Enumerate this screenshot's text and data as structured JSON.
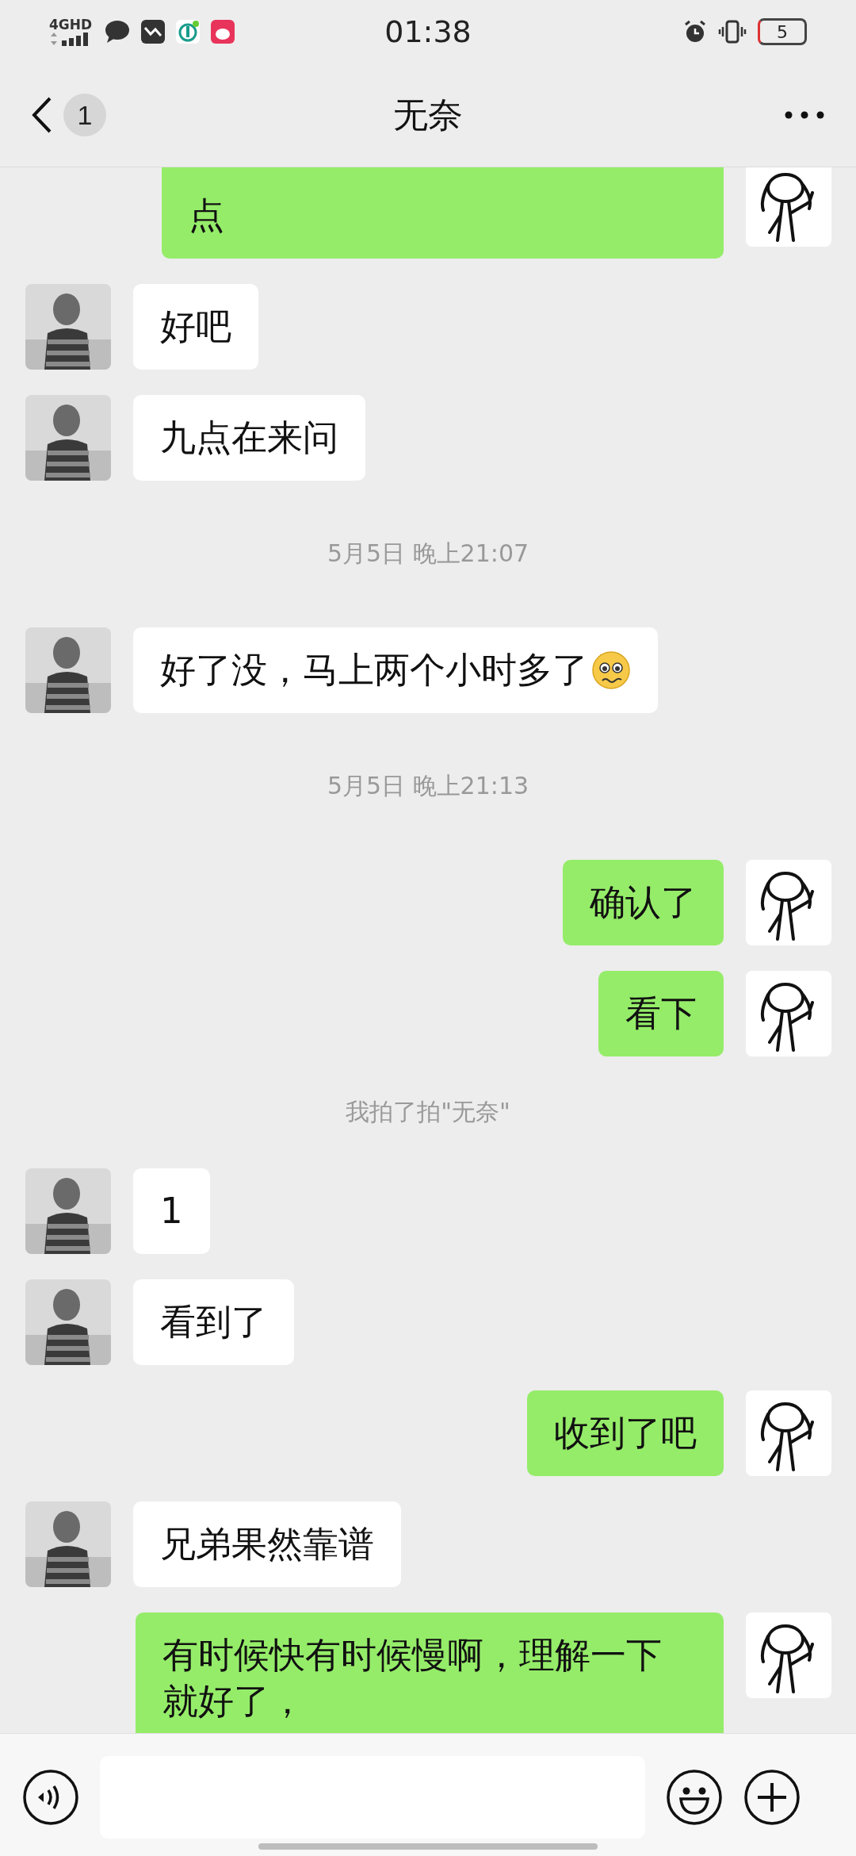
{
  "status_bar": {
    "network": "4GHD",
    "time": "01:38",
    "battery": "5"
  },
  "header": {
    "back_badge": "1",
    "title": "无奈"
  },
  "messages": [
    {
      "kind": "sent",
      "text": "点",
      "continued_above": true
    },
    {
      "kind": "received",
      "text": "好吧"
    },
    {
      "kind": "received",
      "text": "九点在来问"
    },
    {
      "kind": "time",
      "text": "5月5日 晚上21:07"
    },
    {
      "kind": "received",
      "text": "好了没，马上两个小时多了",
      "emoji": true
    },
    {
      "kind": "time",
      "text": "5月5日 晚上21:13"
    },
    {
      "kind": "sent",
      "text": "确认了"
    },
    {
      "kind": "sent",
      "text": "看下"
    },
    {
      "kind": "notice",
      "text": "我拍了拍\"无奈\""
    },
    {
      "kind": "received",
      "text": "1"
    },
    {
      "kind": "received",
      "text": "看到了"
    },
    {
      "kind": "sent",
      "text": "收到了吧"
    },
    {
      "kind": "received",
      "text": "兄弟果然靠谱"
    },
    {
      "kind": "sent",
      "text": "有时候快有时候慢啊，理解一下就好了，"
    }
  ]
}
